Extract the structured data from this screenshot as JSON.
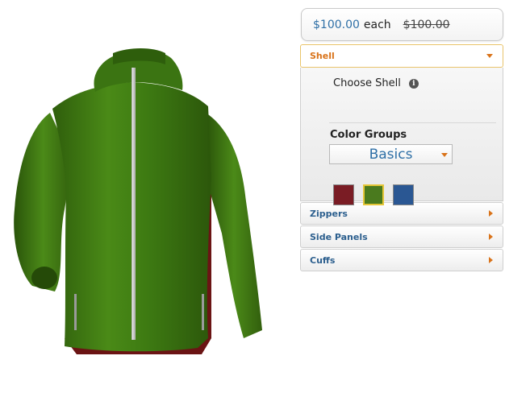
{
  "price": {
    "current": "$100.00",
    "each": "each",
    "original": "$100.00"
  },
  "sections": {
    "shell": {
      "label": "Shell",
      "open": true
    },
    "zippers": {
      "label": "Zippers"
    },
    "side_panels": {
      "label": "Side Panels"
    },
    "cuffs": {
      "label": "Cuffs"
    }
  },
  "shell_panel": {
    "choose_label": "Choose Shell",
    "info_icon": "info-icon",
    "color_groups_label": "Color Groups",
    "color_group_selected": "Basics",
    "swatches": [
      {
        "name": "red",
        "color": "#7a1c24",
        "selected": false
      },
      {
        "name": "green",
        "color": "#4a7a1e",
        "selected": true
      },
      {
        "name": "blue",
        "color": "#2a5793",
        "selected": false
      }
    ]
  },
  "jacket": {
    "shell_color": "#3f7a12",
    "side_panel_color": "#6b1414",
    "zipper_color": "#b8b8b8"
  }
}
